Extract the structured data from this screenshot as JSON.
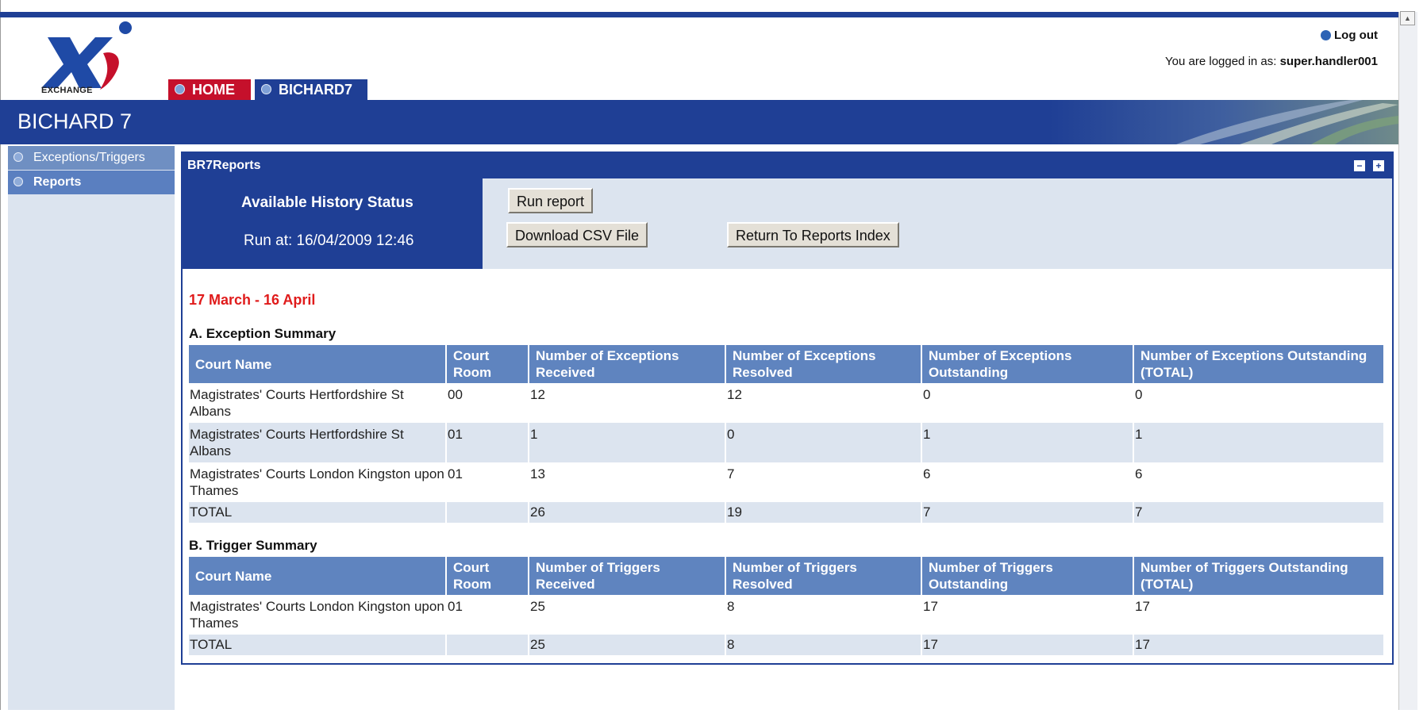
{
  "header": {
    "logo_text": "EXCHANGE",
    "tabs": [
      {
        "label": "HOME"
      },
      {
        "label": "BICHARD7"
      }
    ],
    "logout_label": "Log out",
    "logged_in_prefix": "You are logged in as:",
    "logged_in_user": "super.handler001",
    "banner_title": "BICHARD 7"
  },
  "sidebar": {
    "items": [
      {
        "label": "Exceptions/Triggers"
      },
      {
        "label": "Reports"
      }
    ]
  },
  "panel": {
    "title": "BR7Reports",
    "minimize_icon": "−",
    "maximize_icon": "+",
    "status_title": "Available History Status",
    "run_at": "Run at: 16/04/2009 12:46",
    "buttons": {
      "run_report": "Run report",
      "download_csv": "Download CSV File",
      "return_index": "Return To Reports Index"
    },
    "period": "17 March - 16 April"
  },
  "exception_summary": {
    "title": "A. Exception Summary",
    "headers": [
      "Court Name",
      "Court Room",
      "Number of Exceptions Received",
      "Number of Exceptions Resolved",
      "Number of Exceptions Outstanding",
      "Number of Exceptions Outstanding (TOTAL)"
    ],
    "rows": [
      [
        "Magistrates' Courts Hertfordshire St Albans",
        "00",
        "12",
        "12",
        "0",
        "0"
      ],
      [
        "Magistrates' Courts Hertfordshire St Albans",
        "01",
        "1",
        "0",
        "1",
        "1"
      ],
      [
        "Magistrates' Courts London Kingston upon Thames",
        "01",
        "13",
        "7",
        "6",
        "6"
      ]
    ],
    "total": [
      "TOTAL",
      "",
      "26",
      "19",
      "7",
      "7"
    ]
  },
  "trigger_summary": {
    "title": "B. Trigger Summary",
    "headers": [
      "Court Name",
      "Court Room",
      "Number of Triggers Received",
      "Number of Triggers Resolved",
      "Number of Triggers Outstanding",
      "Number of Triggers Outstanding (TOTAL)"
    ],
    "rows": [
      [
        "Magistrates' Courts London Kingston upon Thames",
        "01",
        "25",
        "8",
        "17",
        "17"
      ]
    ],
    "total": [
      "TOTAL",
      "",
      "25",
      "8",
      "17",
      "17"
    ]
  }
}
